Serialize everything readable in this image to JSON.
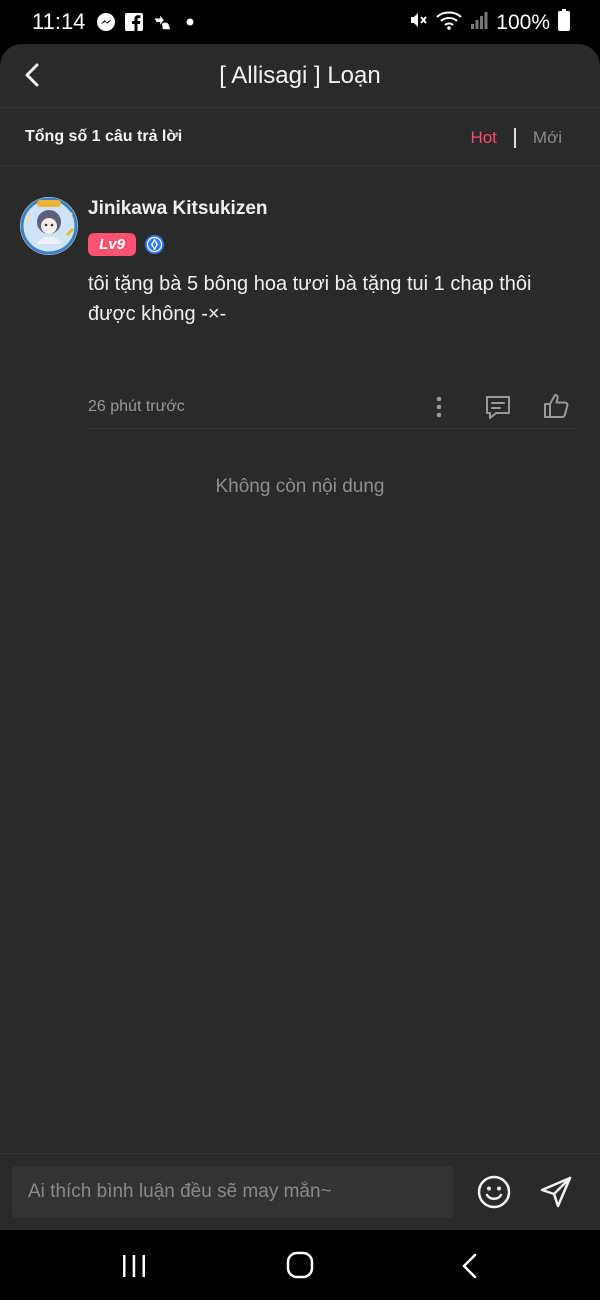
{
  "status_bar": {
    "time": "11:14",
    "battery": "100%",
    "icons": [
      "messenger-icon",
      "facebook-icon",
      "gesture-icon",
      "notification-dot-icon",
      "mute-icon",
      "wifi-icon",
      "signal-icon",
      "battery-icon"
    ]
  },
  "header": {
    "title": "[ Allisagi ] Loạn",
    "back_icon": "chevron-left-icon"
  },
  "summary": {
    "total": "Tổng số 1 câu trả lời",
    "tabs": {
      "hot": "Hot",
      "new": "Mới"
    }
  },
  "comment": {
    "username": "Jinikawa Kitsukizen",
    "level": "Lv9",
    "text": "tôi tặng bà 5 bông hoa tươi bà tặng tui 1 chap thôi được không -×-",
    "time": "26 phút trước"
  },
  "end_message": "Không còn nội dung",
  "composer": {
    "placeholder": "Ai thích bình luận đều sẽ may mắn~"
  },
  "colors": {
    "accent": "#ff4a68",
    "background": "#2a2a2a",
    "badge": "#ff5271",
    "verified": "#2f7df6"
  }
}
